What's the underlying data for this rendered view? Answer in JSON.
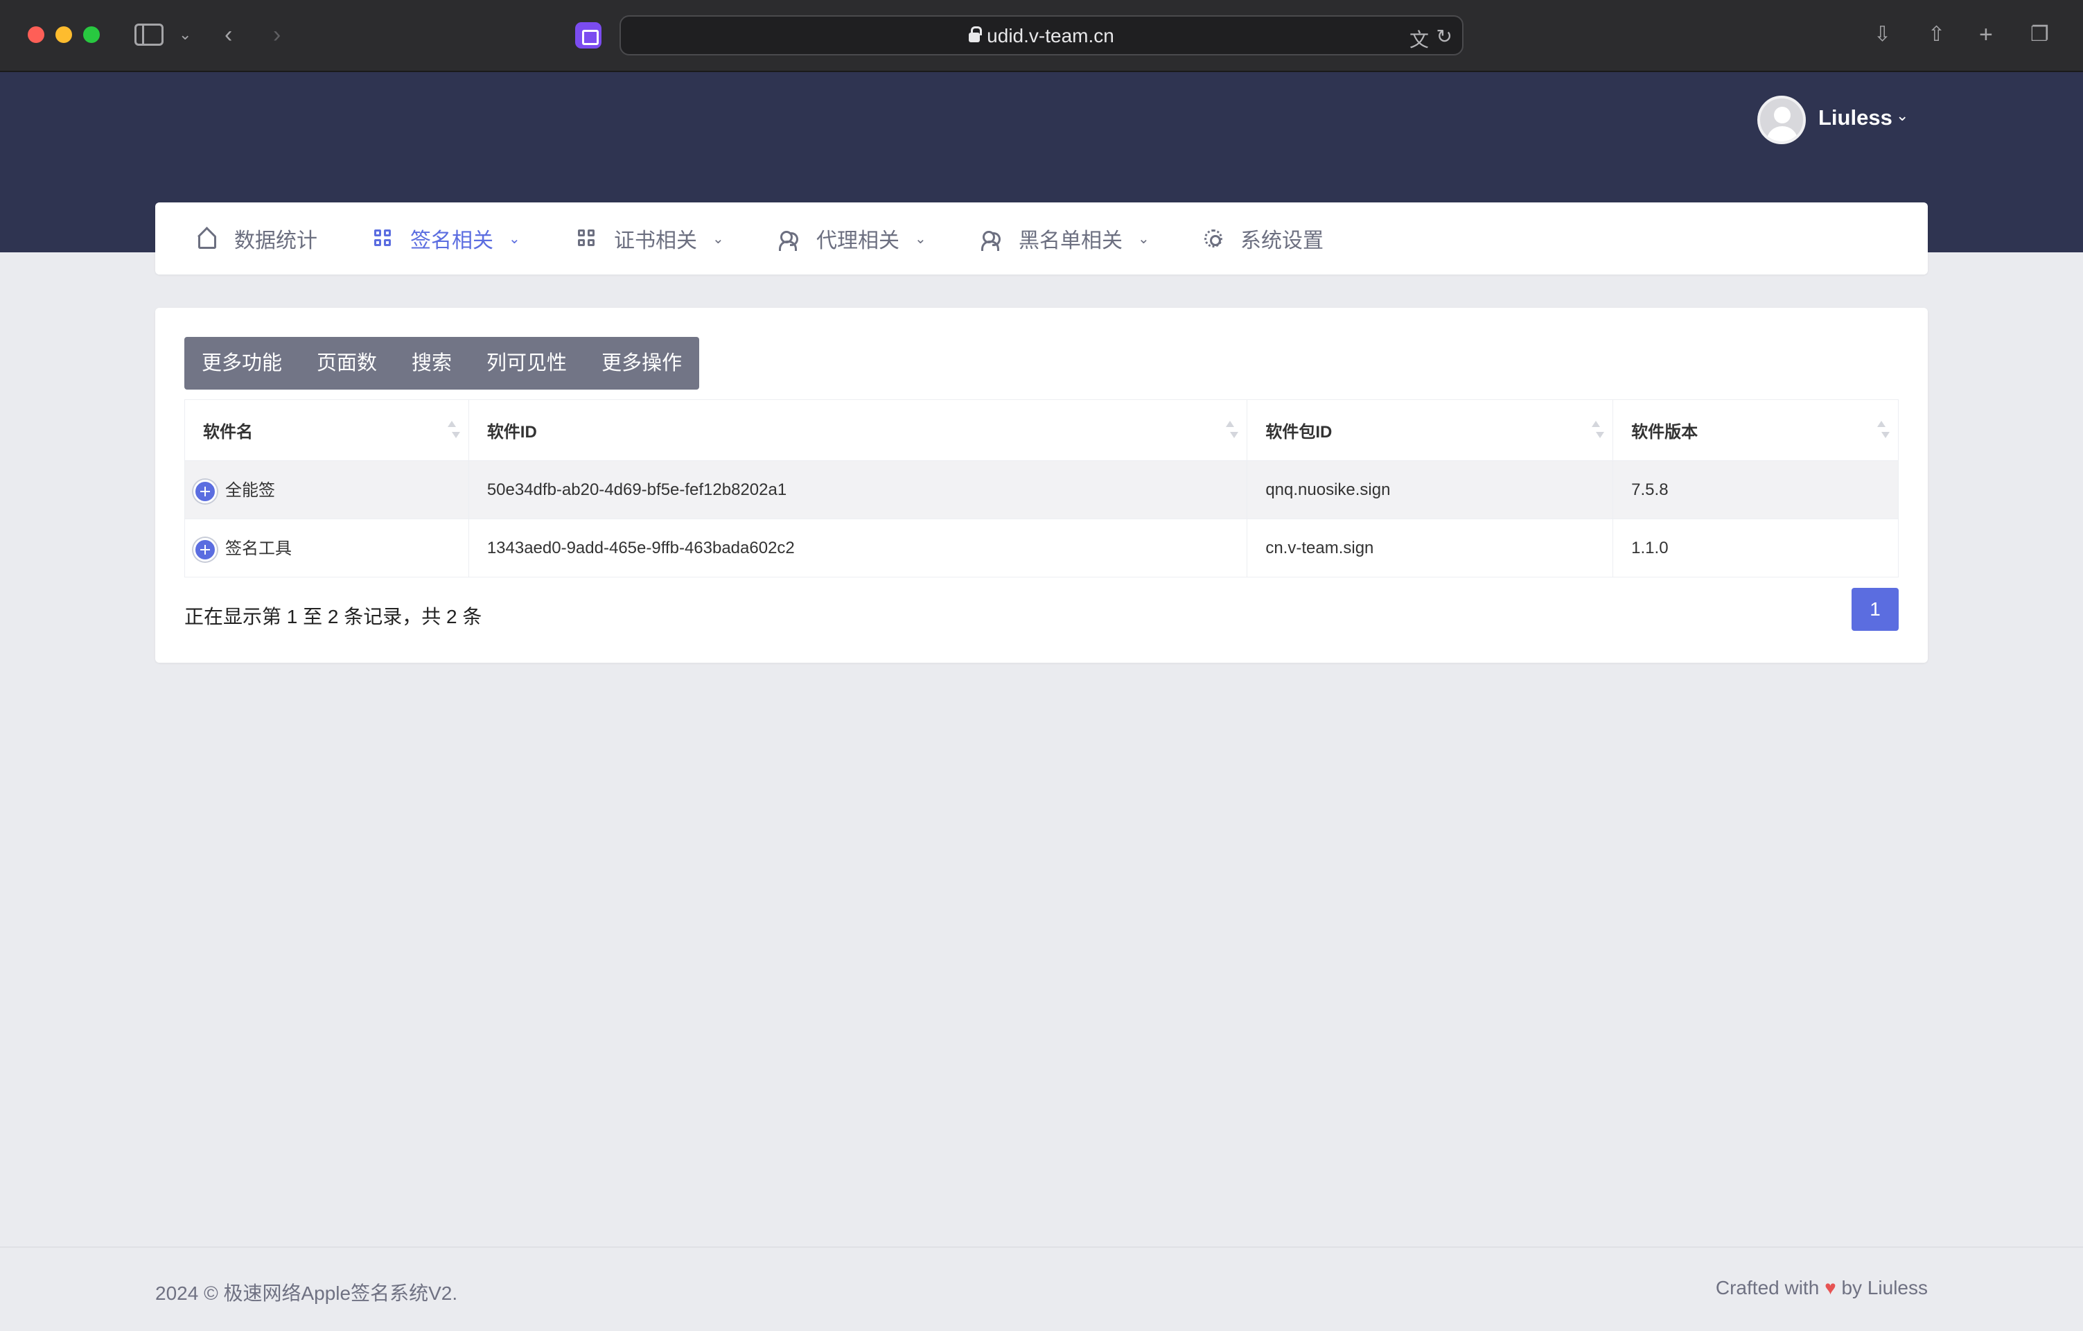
{
  "browser": {
    "url": "udid.v-team.cn"
  },
  "header": {
    "user_name": "Liuless"
  },
  "nav": [
    {
      "label": "数据统计",
      "icon": "home-icon",
      "active": false
    },
    {
      "label": "签名相关",
      "icon": "grid-icon",
      "active": true
    },
    {
      "label": "证书相关",
      "icon": "grid-icon",
      "active": false
    },
    {
      "label": "代理相关",
      "icon": "users-icon",
      "active": false
    },
    {
      "label": "黑名单相关",
      "icon": "users-icon",
      "active": false
    },
    {
      "label": "系统设置",
      "icon": "gear-icon",
      "active": false
    }
  ],
  "toolbar": {
    "more_features": "更多功能",
    "page_size": "页面数",
    "search": "搜索",
    "column_visibility": "列可见性",
    "more_actions": "更多操作"
  },
  "table": {
    "columns": [
      "软件名",
      "软件ID",
      "软件包ID",
      "软件版本"
    ],
    "rows": [
      {
        "name": "全能签",
        "id": "50e34dfb-ab20-4d69-bf5e-fef12b8202a1",
        "bundle": "qnq.nuosike.sign",
        "version": "7.5.8"
      },
      {
        "name": "签名工具",
        "id": "1343aed0-9add-465e-9ffb-463bada602c2",
        "bundle": "cn.v-team.sign",
        "version": "1.1.0"
      }
    ]
  },
  "pagination": {
    "info": "正在显示第 1 至 2 条记录，共 2 条",
    "current_page": "1"
  },
  "footer": {
    "left": "2024 © 极速网络Apple签名系统V2.",
    "crafted": "Crafted with",
    "by": "by Liuless"
  },
  "colors": {
    "accent": "#5b6de0",
    "header_bg": "#2f3451",
    "toolbar_bg": "#727586"
  }
}
